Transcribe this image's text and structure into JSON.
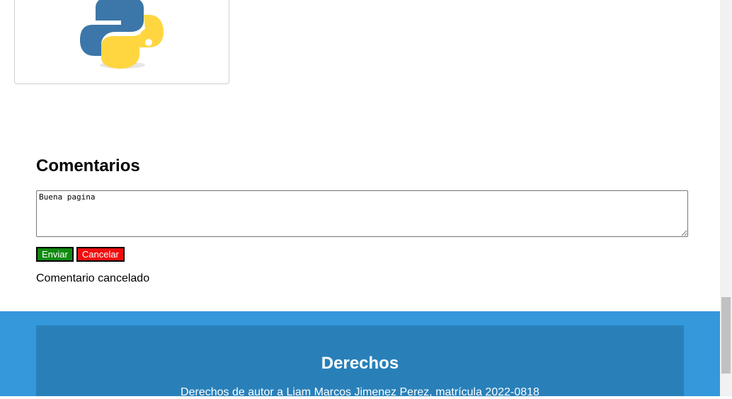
{
  "image_card": {
    "logo": "python-logo-icon"
  },
  "comments": {
    "title": "Comentarios",
    "textarea_value": "Buena pagina",
    "send_label": "Enviar",
    "cancel_label": "Cancelar",
    "status": "Comentario cancelado"
  },
  "footer": {
    "title": "Derechos",
    "text": "Derechos de autor a Liam Marcos Jimenez Perez, matrícula 2022-0818"
  },
  "colors": {
    "footer_outer": "#3498db",
    "footer_inner": "#2980b9",
    "send_button": "#108a10",
    "cancel_button": "#f20d0d"
  }
}
